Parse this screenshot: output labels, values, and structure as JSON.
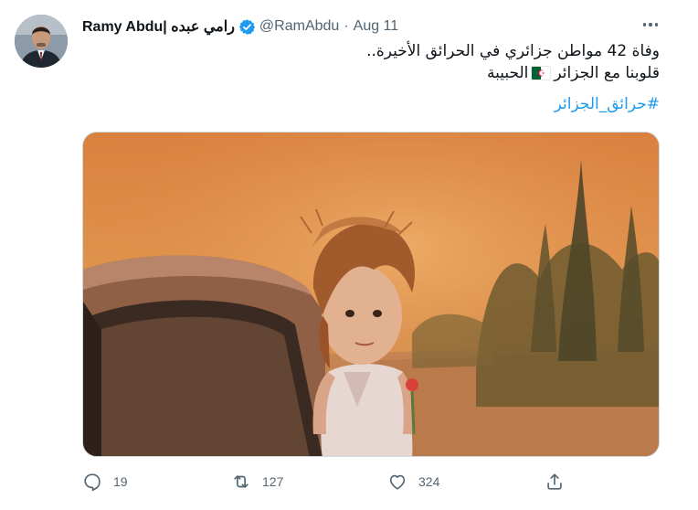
{
  "tweet": {
    "display_name": "Ramy Abdu| رامي عبده",
    "handle": "@RamAbdu",
    "separator": "·",
    "date": "Aug 11",
    "text_line1": "وفاة 42 مواطن جزائري في الحرائق الأخيرة..",
    "text_line2_before_flag": "قلوبنا مع الجزائر",
    "text_line2_after_flag": "الحبيبة",
    "hashtag": "#حرائق_الجزائر",
    "flag_icon": "algeria-flag-icon",
    "media_image": "photo of a young girl standing beside a car with an orange smoky sky from wildfires",
    "accent_color": "#1d9bf0",
    "verified_color": "#1d9bf0"
  },
  "actions": {
    "reply_count": "19",
    "retweet_count": "127",
    "like_count": "324",
    "reply_icon": "reply-icon",
    "retweet_icon": "retweet-icon",
    "like_icon": "heart-icon",
    "share_icon": "share-icon",
    "more_icon": "more-icon"
  }
}
